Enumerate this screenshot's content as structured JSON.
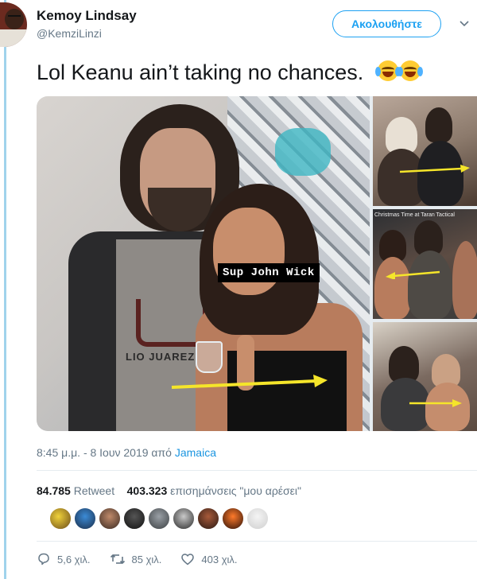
{
  "author": {
    "name": "Kemoy Lindsay",
    "handle": "@KemziLinzi"
  },
  "follow_label": "Ακολουθήστε",
  "tweet": {
    "text": "Lol Keanu ain’t taking no chances."
  },
  "media": {
    "main_caption": "Sup John Wick",
    "main_shirt_text": "LIO JUAREZ",
    "side_caption": "Christmas Time at Taran Tactical"
  },
  "meta": {
    "time": "8:45 μ.μ. - 8 Ιουν 2019 από ",
    "location": "Jamaica"
  },
  "stats": {
    "retweets_count": "84.785",
    "retweets_label": "Retweet",
    "likes_count": "403.323",
    "likes_label": "επισημάνσεις \"μου αρέσει\""
  },
  "actions": {
    "replies": "5,6 χιλ.",
    "retweets": "85 χιλ.",
    "likes": "403 χιλ."
  },
  "colors": {
    "accent": "#1da1f2",
    "arrow": "#f5e52a",
    "thread_rule": "#a0d3ec"
  }
}
